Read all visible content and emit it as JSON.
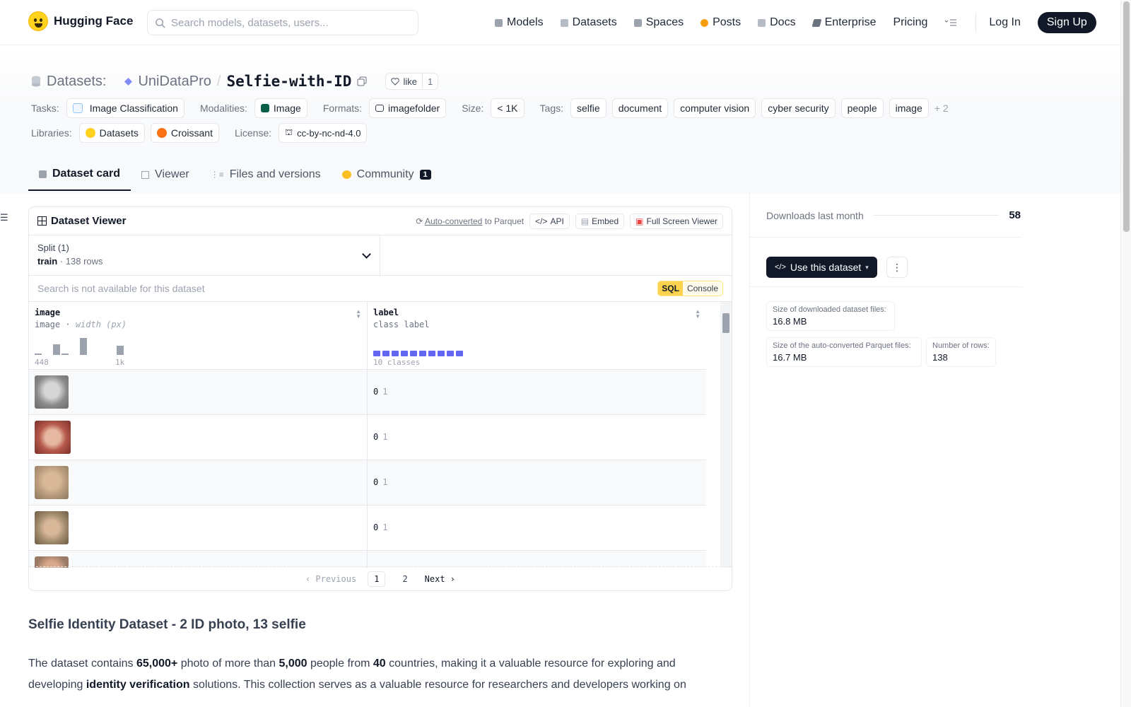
{
  "nav": {
    "brand": "Hugging Face",
    "search_placeholder": "Search models, datasets, users...",
    "links": [
      {
        "label": "Models",
        "color": "#9ca3af"
      },
      {
        "label": "Datasets",
        "color": "#b6bcc6"
      },
      {
        "label": "Spaces",
        "color": "#9ca3af"
      },
      {
        "label": "Posts",
        "color": "#f59e0b"
      },
      {
        "label": "Docs",
        "color": "#b6bcc6"
      },
      {
        "label": "Enterprise",
        "color": "#6b7280"
      },
      {
        "label": "Pricing",
        "color": ""
      }
    ],
    "login": "Log In",
    "signup": "Sign Up"
  },
  "breadcrumb": {
    "section": "Datasets:",
    "org": "UniDataPro",
    "sep": "/",
    "name": "Selfie-with-ID",
    "like_label": "like",
    "like_count": "1"
  },
  "meta": {
    "tasks_label": "Tasks:",
    "task": "Image Classification",
    "modalities_label": "Modalities:",
    "modality": "Image",
    "formats_label": "Formats:",
    "format": "imagefolder",
    "size_label": "Size:",
    "size": "< 1K",
    "tags_label": "Tags:",
    "tags": [
      "selfie",
      "document",
      "computer vision",
      "cyber security",
      "people",
      "image"
    ],
    "tags_more": "+ 2",
    "libraries_label": "Libraries:",
    "libraries": [
      "Datasets",
      "Croissant"
    ],
    "license_label": "License:",
    "license": "cc-by-nc-nd-4.0"
  },
  "tabs": [
    {
      "label": "Dataset card",
      "active": true
    },
    {
      "label": "Viewer"
    },
    {
      "label": "Files and versions"
    },
    {
      "label": "Community",
      "badge": "1"
    }
  ],
  "viewer": {
    "title": "Dataset Viewer",
    "auto_converted": "Auto-converted",
    "to_parquet": "to Parquet",
    "api": "API",
    "embed": "Embed",
    "fullscreen": "Full Screen Viewer",
    "split_label": "Split (1)",
    "split_name": "train",
    "split_rows": "138 rows",
    "search_disabled": "Search is not available for this dataset",
    "sql": "SQL",
    "console": "Console",
    "columns": [
      {
        "name": "image",
        "type": "image",
        "type_note": "width (px)",
        "axis_min": "448",
        "axis_max": "1k"
      },
      {
        "name": "label",
        "type": "class label",
        "classes_text": "10 classes"
      }
    ],
    "rows": [
      {
        "label": "0",
        "label_name": "1",
        "thumb_color": "#8a8a8a"
      },
      {
        "label": "0",
        "label_name": "1",
        "thumb_color": "#b5584a"
      },
      {
        "label": "0",
        "label_name": "1",
        "thumb_color": "#b89a7a"
      },
      {
        "label": "0",
        "label_name": "1",
        "thumb_color": "#a08a6c"
      }
    ],
    "pager": {
      "previous": "Previous",
      "pages": [
        "1",
        "2"
      ],
      "next": "Next"
    }
  },
  "article": {
    "title": "Selfie Identity Dataset - 2 ID photo, 13 selfie",
    "p1_a": "The dataset contains ",
    "p1_b": "65,000+",
    "p1_c": " photo of more than ",
    "p1_d": "5,000",
    "p1_e": " people from ",
    "p1_f": "40",
    "p1_g": " countries, making it a valuable resource for exploring and developing ",
    "p1_h": "identity verification",
    "p1_i": " solutions. This collection serves as a valuable resource for researchers and developers working on"
  },
  "sidebar": {
    "downloads_label": "Downloads last month",
    "downloads_value": "58",
    "use_dataset": "Use this dataset",
    "stats": [
      {
        "k": "Size of downloaded dataset files:",
        "v": "16.8 MB"
      },
      {
        "k": "Size of the auto-converted Parquet files:",
        "v": "16.7 MB"
      },
      {
        "k": "Number of rows:",
        "v": "138"
      }
    ]
  }
}
